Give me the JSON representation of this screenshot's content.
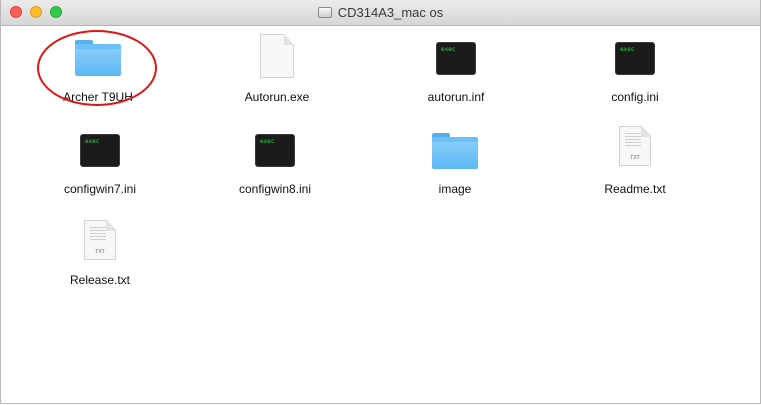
{
  "window": {
    "title": "CD314A3_mac os"
  },
  "items": [
    {
      "name": "Archer T9UH",
      "icon": "folder-icon"
    },
    {
      "name": "Autorun.exe",
      "icon": "document-icon"
    },
    {
      "name": "autorun.inf",
      "icon": "exec-icon",
      "badge": "exec"
    },
    {
      "name": "config.ini",
      "icon": "exec-icon",
      "badge": "exec"
    },
    {
      "name": "configwin7.ini",
      "icon": "exec-icon",
      "badge": "exec"
    },
    {
      "name": "configwin8.ini",
      "icon": "exec-icon",
      "badge": "exec"
    },
    {
      "name": "image",
      "icon": "folder-icon"
    },
    {
      "name": "Readme.txt",
      "icon": "text-document-icon",
      "ext": "TXT"
    },
    {
      "name": "Release.txt",
      "icon": "text-document-icon",
      "ext": "TXT"
    }
  ],
  "annotation": {
    "color": "#e11515",
    "target": "Archer T9UH"
  }
}
